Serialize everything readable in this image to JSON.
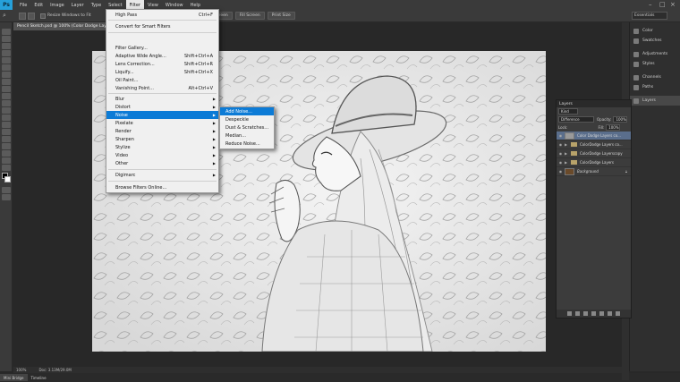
{
  "menubar": {
    "logo": "Ps",
    "items": [
      "File",
      "Edit",
      "Image",
      "Layer",
      "Type",
      "Select",
      "Filter",
      "View",
      "Window",
      "Help"
    ],
    "active": "Filter"
  },
  "options": {
    "resize_label": "Resize Windows to Fit",
    "buttons": [
      "Fit Screen",
      "Fill Screen",
      "Print Size"
    ],
    "workspace": "Essentials"
  },
  "document": {
    "tab_title": "Pencil Sketch.psd @ 100% (Color Dodge Lay..."
  },
  "status": {
    "zoom": "100%",
    "doc": "Doc: 3.13M/29.0M"
  },
  "bottom_tabs": [
    "Mini Bridge",
    "Timeline"
  ],
  "filter_menu": {
    "items": [
      {
        "label": "High Pass",
        "shortcut": "Ctrl+F"
      },
      {
        "label": "Convert for Smart Filters"
      },
      {
        "label": "Filter Gallery..."
      },
      {
        "label": "Adaptive Wide Angle...",
        "shortcut": "Shift+Ctrl+A"
      },
      {
        "label": "Lens Correction...",
        "shortcut": "Shift+Ctrl+R"
      },
      {
        "label": "Liquify...",
        "shortcut": "Shift+Ctrl+X"
      },
      {
        "label": "Oil Paint..."
      },
      {
        "label": "Vanishing Point...",
        "shortcut": "Alt+Ctrl+V"
      },
      {
        "label": "Blur"
      },
      {
        "label": "Distort"
      },
      {
        "label": "Noise"
      },
      {
        "label": "Pixelate"
      },
      {
        "label": "Render"
      },
      {
        "label": "Sharpen"
      },
      {
        "label": "Stylize"
      },
      {
        "label": "Video"
      },
      {
        "label": "Other"
      },
      {
        "label": "Digimarc"
      },
      {
        "label": "Browse Filters Online..."
      }
    ]
  },
  "noise_menu": {
    "items": [
      "Add Noise...",
      "Despeckle",
      "Dust & Scratches...",
      "Median...",
      "Reduce Noise..."
    ]
  },
  "right_dock": {
    "items": [
      "Color",
      "Swatches",
      "Adjustments",
      "Styles",
      "Channels",
      "Paths",
      "Layers"
    ]
  },
  "layers_panel": {
    "title": "Layers",
    "kind": "Kind",
    "blend": "Difference",
    "opacity_label": "Opacity:",
    "opacity": "100%",
    "lock_label": "Lock:",
    "fill_label": "Fill:",
    "fill": "100%",
    "layers": [
      "Color Dodge Layers co...",
      "ColorDodge Layers co...",
      "ColorDodge Layerscopy",
      "ColorDodge Layers",
      "Background"
    ]
  }
}
